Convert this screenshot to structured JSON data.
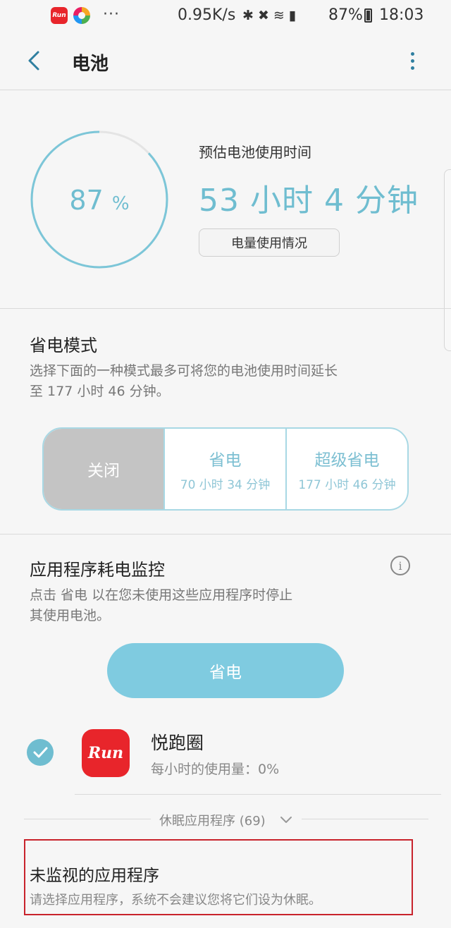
{
  "status_bar": {
    "app1_label": "Run",
    "dots": "···",
    "speed": "0.95K/s",
    "icons": "✱ ✖ ≋ ▮",
    "battery_percent": "87%",
    "time": "18:03"
  },
  "header": {
    "title": "电池"
  },
  "battery": {
    "percent_value": "87",
    "percent_unit": "%",
    "level": 0.87,
    "estimate_label": "预估电池使用时间",
    "estimate_time": "53 小时 4 分钟",
    "usage_button": "电量使用情况"
  },
  "power_mode": {
    "title": "省电模式",
    "description_line1": "选择下面的一种模式最多可将您的电池使用时间延长",
    "description_line2": "至 177 小时 46 分钟。",
    "modes": [
      {
        "name": "关闭",
        "sub": ""
      },
      {
        "name": "省电",
        "sub": "70 小时 34 分钟"
      },
      {
        "name": "超级省电",
        "sub": "177 小时 46 分钟"
      }
    ]
  },
  "app_monitor": {
    "title": "应用程序耗电监控",
    "info_icon": "i",
    "description_line1": "点击 省电 以在您未使用这些应用程序时停止",
    "description_line2": "其使用电池。",
    "save_button": "省电",
    "apps": [
      {
        "name": "悦跑圈",
        "usage": "每小时的使用量：0%",
        "icon_text": "Run",
        "checked": true
      }
    ],
    "sleeping_apps_label": "休眠应用程序 (69)"
  },
  "unmonitored": {
    "title": "未监视的应用程序",
    "description": "请选择应用程序，系统不会建议您将它们设为休眠。"
  },
  "colors": {
    "accent": "#6fbdd0",
    "highlight_border": "#c8232c",
    "app_red": "#e8252b"
  }
}
